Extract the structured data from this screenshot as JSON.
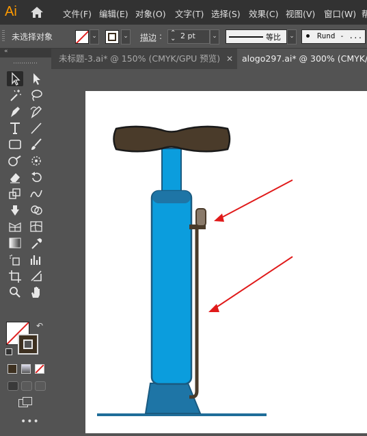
{
  "app": {
    "logo": "Ai"
  },
  "menu": [
    "文件(F)",
    "编辑(E)",
    "对象(O)",
    "文字(T)",
    "选择(S)",
    "效果(C)",
    "视图(V)",
    "窗口(W)",
    "帮"
  ],
  "control": {
    "selection_status": "未选择对象",
    "stroke_label": "描边",
    "stroke_colon": ":",
    "stroke_value": "2 pt",
    "profile_label": "等比",
    "brush_value": "Rund - ..."
  },
  "tabs": [
    {
      "label": "未标题-3.ai* @ 150% (CMYK/GPU 预览)",
      "active": false
    },
    {
      "label": "alogo297.ai* @ 300% (CMYK/GPU",
      "active": true
    }
  ],
  "colors": {
    "fill": "none",
    "stroke": "#3d3020",
    "pump_blue": "#0b9ddd",
    "pump_dark_blue": "#1e6f99",
    "handle_brown": "#4a3b2a",
    "arrow_red": "#e01a1a"
  },
  "tools": [
    "selection-tool-icon",
    "direct-selection-tool-icon",
    "magic-wand-icon",
    "lasso-icon",
    "pen-tool-icon",
    "curvature-tool-icon",
    "type-tool-icon",
    "line-tool-icon",
    "rectangle-tool-icon",
    "paintbrush-icon",
    "shaper-tool-icon",
    "blob-brush-icon",
    "eraser-icon",
    "rotate-tool-icon",
    "scale-tool-icon",
    "warp-tool-icon",
    "puppet-warp-icon",
    "shape-builder-icon",
    "perspective-grid-icon",
    "mesh-tool-icon",
    "gradient-tool-icon",
    "eyedropper-icon",
    "symbol-sprayer-icon",
    "column-graph-icon",
    "artboard-tool-icon",
    "slice-tool-icon",
    "zoom-tool-icon",
    "hand-tool-icon"
  ]
}
